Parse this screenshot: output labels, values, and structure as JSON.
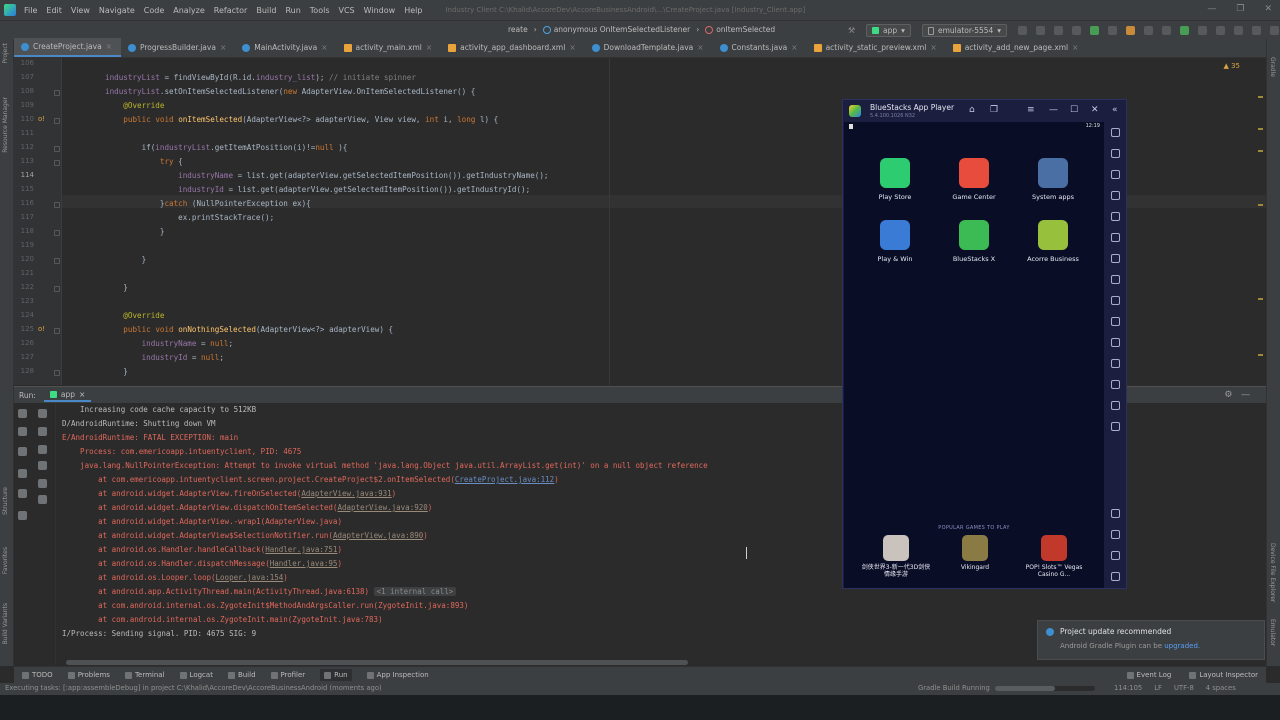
{
  "menu": {
    "items": [
      "File",
      "Edit",
      "View",
      "Navigate",
      "Code",
      "Analyze",
      "Refactor",
      "Build",
      "Run",
      "Tools",
      "VCS",
      "Window",
      "Help"
    ],
    "window_title": "Industry Client C:\\Khalid\\AccoreDev\\AccoreBusinessAndroid\\...\\CreateProject.java [Industry_Client.app]"
  },
  "navbar": {
    "crumb_tail": "reate",
    "crumb_listener": "anonymous OnItemSelectedListener",
    "crumb_method": "onItemSelected",
    "run_config": "app",
    "device": "emulator-5554"
  },
  "tabs": [
    {
      "label": "CreateProject.java",
      "kind": "java",
      "active": true
    },
    {
      "label": "ProgressBuilder.java",
      "kind": "java",
      "active": false
    },
    {
      "label": "MainActivity.java",
      "kind": "java",
      "active": false
    },
    {
      "label": "activity_main.xml",
      "kind": "xml",
      "active": false
    },
    {
      "label": "activity_app_dashboard.xml",
      "kind": "xml",
      "active": false
    },
    {
      "label": "DownloadTemplate.java",
      "kind": "java",
      "active": false
    },
    {
      "label": "Constants.java",
      "kind": "java",
      "active": false
    },
    {
      "label": "activity_static_preview.xml",
      "kind": "xml",
      "active": false
    },
    {
      "label": "activity_add_new_page.xml",
      "kind": "xml",
      "active": false
    }
  ],
  "editor": {
    "warnings": "35",
    "current_line": "114",
    "lines": [
      {
        "n": "106",
        "code": ""
      },
      {
        "n": "107",
        "code": "industryList = findViewById(R.id.industry_list); // initiate spinner"
      },
      {
        "n": "108",
        "code": "industryList.setOnItemSelectedListener(new AdapterView.OnItemSelectedListener() {"
      },
      {
        "n": "109",
        "code": "    @Override"
      },
      {
        "n": "110",
        "code": "    public void onItemSelected(AdapterView<?> adapterView, View view, int i, long l) {"
      },
      {
        "n": "111",
        "code": ""
      },
      {
        "n": "112",
        "code": "        if(industryList.getItemAtPosition(i)!=null ){"
      },
      {
        "n": "113",
        "code": "            try {"
      },
      {
        "n": "114",
        "code": "                industryName = list.get(adapterView.getSelectedItemPosition()).getIndustryName();"
      },
      {
        "n": "115",
        "code": "                industryId = list.get(adapterView.getSelectedItemPosition()).getIndustryId();"
      },
      {
        "n": "116",
        "code": "            }catch (NullPointerException ex){"
      },
      {
        "n": "117",
        "code": "                ex.printStackTrace();"
      },
      {
        "n": "118",
        "code": "            }"
      },
      {
        "n": "119",
        "code": ""
      },
      {
        "n": "120",
        "code": "        }"
      },
      {
        "n": "121",
        "code": ""
      },
      {
        "n": "122",
        "code": "    }"
      },
      {
        "n": "123",
        "code": ""
      },
      {
        "n": "124",
        "code": "    @Override"
      },
      {
        "n": "125",
        "code": "    public void onNothingSelected(AdapterView<?> adapterView) {"
      },
      {
        "n": "126",
        "code": "        industryName = null;"
      },
      {
        "n": "127",
        "code": "        industryId = null;"
      },
      {
        "n": "128",
        "code": "    }"
      }
    ]
  },
  "run": {
    "label": "Run:",
    "tab": "app",
    "console": [
      {
        "text": "    Increasing code cache capacity to 512KB",
        "err": false
      },
      {
        "text": "D/AndroidRuntime: Shutting down VM",
        "err": false
      },
      {
        "text": "E/AndroidRuntime: FATAL EXCEPTION: main",
        "err": true
      },
      {
        "text": "    Process: com.emericoapp.intuentyclient, PID: 4675",
        "err": true
      },
      {
        "text": "    java.lang.NullPointerException: Attempt to invoke virtual method 'java.lang.Object java.util.ArrayList.get(int)' on a null object reference",
        "err": true
      },
      {
        "text": "        at com.emericoapp.intuentyclient.screen.project.CreateProject$2.onItemSelected(",
        "link": "CreateProject.java:112",
        "tail": ")",
        "err": true
      },
      {
        "text": "        at android.widget.AdapterView.fireOnSelected(",
        "dim": "AdapterView.java:931",
        "tail": ")",
        "err": true
      },
      {
        "text": "        at android.widget.AdapterView.dispatchOnItemSelected(",
        "dim": "AdapterView.java:920",
        "tail": ")",
        "err": true
      },
      {
        "text": "        at android.widget.AdapterView.-wrap1(AdapterView.java)",
        "err": true
      },
      {
        "text": "        at android.widget.AdapterView$SelectionNotifier.run(",
        "dim": "AdapterView.java:890",
        "tail": ")",
        "err": true
      },
      {
        "text": "        at android.os.Handler.handleCallback(",
        "dim": "Handler.java:751",
        "tail": ")",
        "err": true
      },
      {
        "text": "        at android.os.Handler.dispatchMessage(",
        "dim": "Handler.java:95",
        "tail": ")",
        "err": true
      },
      {
        "text": "        at android.os.Looper.loop(",
        "dim": "Looper.java:154",
        "tail": ")",
        "err": true
      },
      {
        "text": "        at android.app.ActivityThread.main(ActivityThread.java:6138) ",
        "chip": "<1 internal call>",
        "err": true
      },
      {
        "text": "        at com.android.internal.os.ZygoteInit$MethodAndArgsCaller.run(ZygoteInit.java:893)",
        "err": true
      },
      {
        "text": "        at com.android.internal.os.ZygoteInit.main(ZygoteInit.java:783)",
        "err": true
      },
      {
        "text": "I/Process: Sending signal. PID: 4675 SIG: 9",
        "err": false
      }
    ]
  },
  "bottom_tabs": [
    "TODO",
    "Problems",
    "Terminal",
    "Logcat",
    "Build",
    "Profiler",
    "Run",
    "App Inspection"
  ],
  "bottom_right_tabs": [
    "Event Log",
    "Layout Inspector"
  ],
  "status": {
    "left": "Executing tasks: [:app:assembleDebug] in project C:\\Khalid\\AccoreDev\\AccoreBusinessAndroid (moments ago)",
    "gradle": "Gradle Build Running",
    "position": "114:105",
    "line_sep": "LF",
    "encoding": "UTF-8",
    "indent": "4 spaces"
  },
  "notification": {
    "title": "Project update recommended",
    "body": "Android Gradle Plugin can be ",
    "link": "upgraded."
  },
  "left_strip": [
    "Project",
    "Resource Manager",
    "Structure",
    "Favorites",
    "Build Variants"
  ],
  "right_strip": [
    "Gradle",
    "Device File Explorer",
    "Emulator"
  ],
  "bluestacks": {
    "title": "BlueStacks App Player",
    "version": "5.4.100.1026 N32",
    "time": "12:19",
    "apps": [
      {
        "label": "Play Store",
        "color": "#2ecc71"
      },
      {
        "label": "Game Center",
        "color": "#e74c3c"
      },
      {
        "label": "System apps",
        "color": "#4a6fa5"
      },
      {
        "label": "Play & Win",
        "color": "#3a7bd5"
      },
      {
        "label": "BlueStacks X",
        "color": "#3cba54"
      },
      {
        "label": "Acorre Business",
        "color": "#97c03d"
      }
    ],
    "popular_label": "POPULAR GAMES TO PLAY",
    "games": [
      {
        "label": "剑侠世界3-新一代3D剑侠情缘手游",
        "color": "#c9c2bd"
      },
      {
        "label": "Vikingard",
        "color": "#8a7b45"
      },
      {
        "label": "POP! Slots™ Vegas Casino G...",
        "color": "#c0392b"
      }
    ]
  }
}
